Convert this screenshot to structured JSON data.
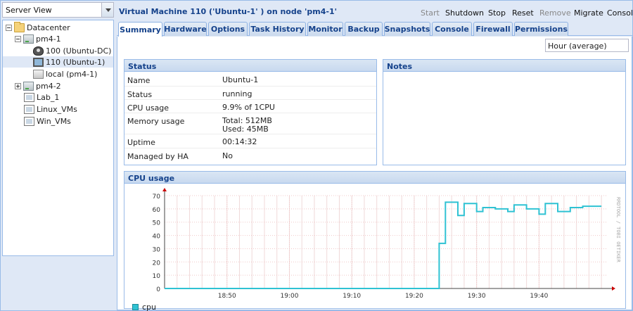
{
  "left_panel": {
    "view_selector": "Server View",
    "tree": [
      {
        "label": "Datacenter",
        "icon": "folder-icon"
      },
      {
        "label": "pm4-1",
        "icon": "server-icon"
      },
      {
        "label": "100 (Ubuntu-DC)",
        "icon": "vm-icon"
      },
      {
        "label": "110 (Ubuntu-1)",
        "icon": "monitor-icon"
      },
      {
        "label": "local (pm4-1)",
        "icon": "storage-icon"
      },
      {
        "label": "pm4-2",
        "icon": "server-icon"
      },
      {
        "label": "Lab_1",
        "icon": "pool-icon"
      },
      {
        "label": "Linux_VMs",
        "icon": "pool-icon"
      },
      {
        "label": "Win_VMs",
        "icon": "pool-icon"
      }
    ]
  },
  "header": {
    "title": "Virtual Machine 110 ('Ubuntu-1' ) on node 'pm4-1'",
    "actions": [
      "Start",
      "Shutdown",
      "Stop",
      "Reset",
      "Remove",
      "Migrate",
      "Console"
    ]
  },
  "tabs": [
    "Summary",
    "Hardware",
    "Options",
    "Task History",
    "Monitor",
    "Backup",
    "Snapshots",
    "Console",
    "Firewall",
    "Permissions"
  ],
  "timeframe": "Hour (average)",
  "status": {
    "title": "Status",
    "rows": [
      {
        "key": "Name",
        "value": "Ubuntu-1"
      },
      {
        "key": "Status",
        "value": "running"
      },
      {
        "key": "CPU usage",
        "value": "9.9% of 1CPU"
      },
      {
        "key": "Memory usage",
        "value": "Total: 512MB\nUsed: 45MB"
      },
      {
        "key": "Uptime",
        "value": "00:14:32"
      },
      {
        "key": "Managed by HA",
        "value": "No"
      }
    ]
  },
  "notes": {
    "title": "Notes"
  },
  "cpu_panel": {
    "title": "CPU usage"
  },
  "colors": {
    "series": "#2fc2d3",
    "header_text": "#15428b",
    "border": "#99bbe8"
  },
  "chart_data": {
    "type": "line",
    "title": "CPU usage",
    "watermark": "RRDTOOL / TOBI OETIKER",
    "ylim": [
      0,
      70
    ],
    "yticks": [
      0,
      10,
      20,
      30,
      40,
      50,
      60,
      70
    ],
    "xticks": [
      "18:50",
      "19:00",
      "19:10",
      "19:20",
      "19:30",
      "19:40"
    ],
    "xtick_minutes": [
      10,
      20,
      30,
      40,
      50,
      60
    ],
    "xlim_minutes": [
      0,
      71
    ],
    "grid": true,
    "legend": "bottom-left",
    "series": [
      {
        "name": "cpu",
        "step": true,
        "x_minutes": [
          0,
          44,
          44,
          45,
          45,
          46,
          46,
          47,
          47,
          48,
          48,
          49,
          49,
          50,
          50,
          51,
          51,
          52,
          52,
          53,
          53,
          54,
          54,
          55,
          55,
          56,
          56,
          57,
          57,
          58,
          58,
          59,
          59,
          60,
          60,
          61,
          61,
          62,
          62,
          63,
          63,
          64,
          64,
          65,
          65,
          66,
          66,
          67,
          67,
          68,
          68,
          69,
          69,
          70
        ],
        "values": [
          0,
          0,
          34,
          34,
          65,
          65,
          65,
          65,
          55,
          55,
          64,
          64,
          64,
          64,
          58,
          58,
          61,
          61,
          61,
          61,
          60,
          60,
          60,
          60,
          58,
          58,
          63,
          63,
          63,
          63,
          60,
          60,
          60,
          60,
          56,
          56,
          64,
          64,
          64,
          64,
          58,
          58,
          58,
          58,
          61,
          61,
          61,
          61,
          62,
          62,
          62,
          62,
          62,
          62
        ]
      }
    ]
  }
}
